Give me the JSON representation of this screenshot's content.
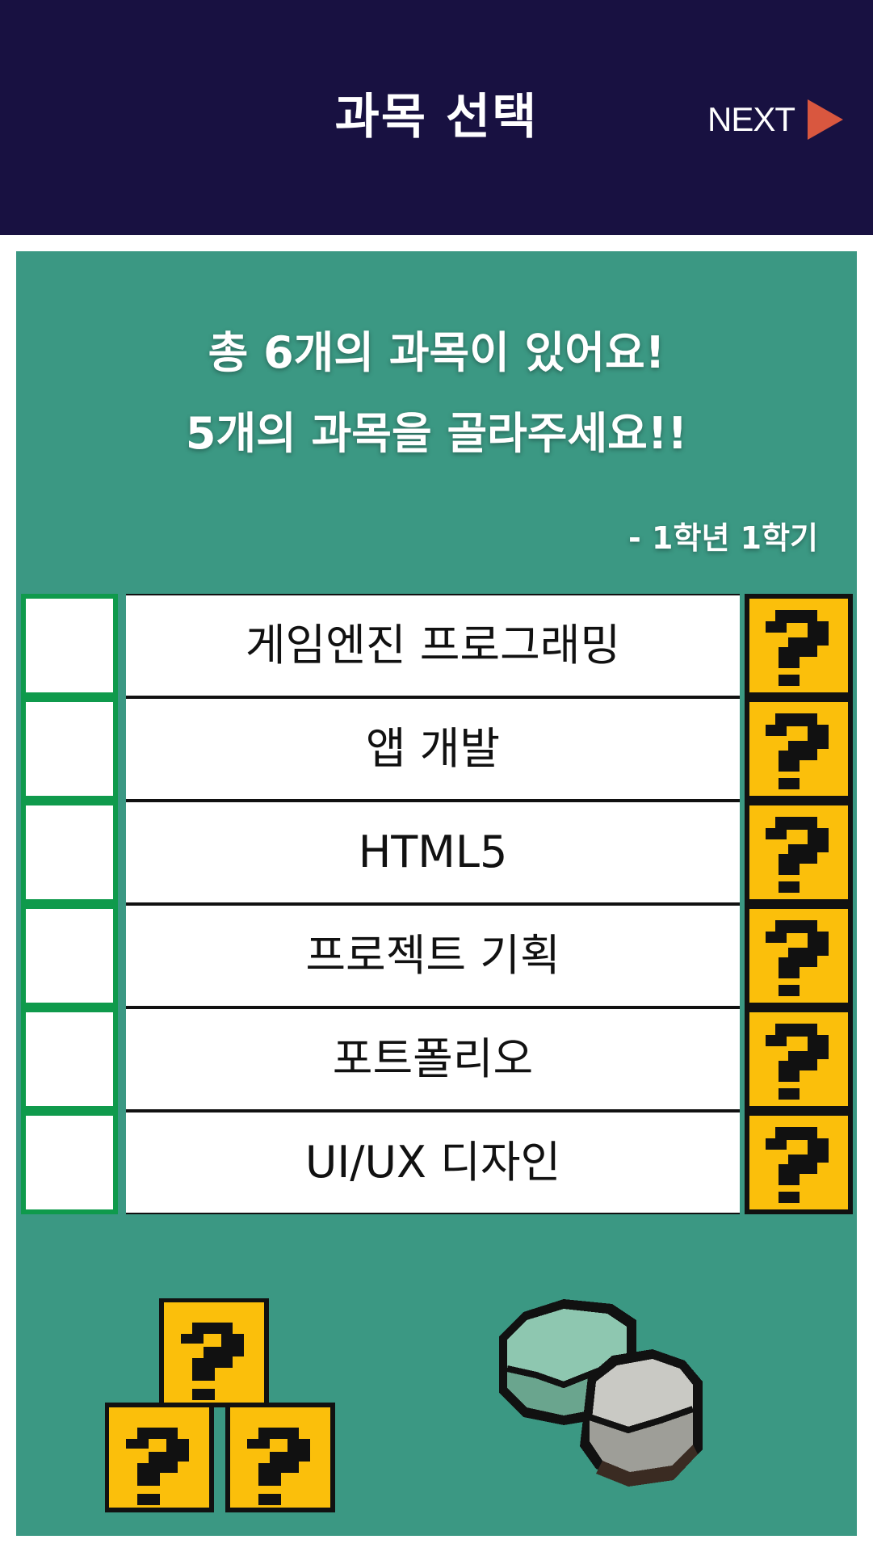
{
  "header": {
    "title": "과목 선택",
    "next_label": "NEXT",
    "background": "#181141",
    "arrow_color": "#d9573f"
  },
  "intro": {
    "line1": "총 6개의 과목이 있어요!",
    "line2": "5개의 과목을 골라주세요!!",
    "semester": "- 1학년 1학기"
  },
  "courses": [
    {
      "name": "게임엔진 프로그래밍",
      "checked": false
    },
    {
      "name": "앱 개발",
      "checked": false
    },
    {
      "name": "HTML5",
      "checked": false
    },
    {
      "name": "프로젝트 기획",
      "checked": false
    },
    {
      "name": "포트폴리오",
      "checked": false
    },
    {
      "name": "UI/UX 디자인",
      "checked": false
    }
  ],
  "colors": {
    "panel": "#3b9883",
    "checkbox_border": "#0f9a4c",
    "question_block": "#fbbf0b"
  },
  "icons": {
    "row_icon": "question-block-icon",
    "decor_left": "question-blocks-stack",
    "decor_right": "pixel-stones"
  }
}
